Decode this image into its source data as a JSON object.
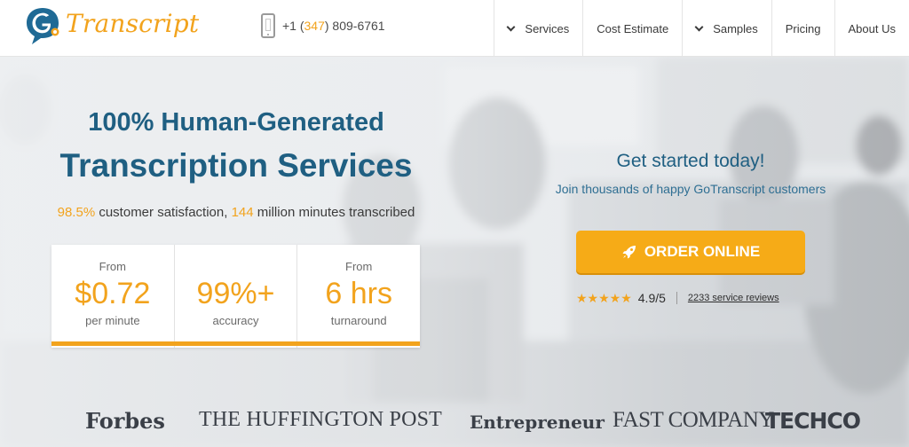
{
  "header": {
    "logo": {
      "text": "Transcript",
      "mark_letters": "Go"
    },
    "phone": {
      "prefix": "+1 (",
      "area_code": "347",
      "suffix": ") 809-6761"
    },
    "nav": [
      {
        "label": "Services",
        "has_dropdown": true
      },
      {
        "label": "Cost Estimate",
        "has_dropdown": false
      },
      {
        "label": "Samples",
        "has_dropdown": true
      },
      {
        "label": "Pricing",
        "has_dropdown": false
      },
      {
        "label": "About Us",
        "has_dropdown": false
      }
    ]
  },
  "hero": {
    "headline_1": "100% Human-Generated",
    "headline_2": "Transcription Services",
    "stats": {
      "satisfaction_value": "98.5%",
      "satisfaction_text": " customer satisfaction, ",
      "minutes_value": "144",
      "minutes_text": " million minutes transcribed"
    },
    "cards": [
      {
        "from": "From",
        "big": "$0.72",
        "sub": "per minute"
      },
      {
        "from": "",
        "big": "99%+",
        "sub": "accuracy"
      },
      {
        "from": "From",
        "big": "6 hrs",
        "sub": "turnaround"
      }
    ],
    "cta": {
      "title": "Get started today!",
      "subtitle": "Join thousands of happy GoTranscript customers",
      "button_label": "ORDER ONLINE",
      "stars": "★★★★★",
      "score": "4.9/5",
      "reviews_link": "2233 service reviews"
    },
    "press": [
      "Forbes",
      "THE HUFFINGTON POST",
      "Entrepreneur",
      "FAST COMPANY",
      "TECHCO"
    ]
  },
  "colors": {
    "accent": "#f2a31d",
    "brand_blue": "#1f5f82",
    "button": "#f6ab17"
  },
  "icons": [
    "go-logo-icon",
    "phone-icon",
    "chevron-down-icon",
    "rocket-icon",
    "star-icon"
  ]
}
